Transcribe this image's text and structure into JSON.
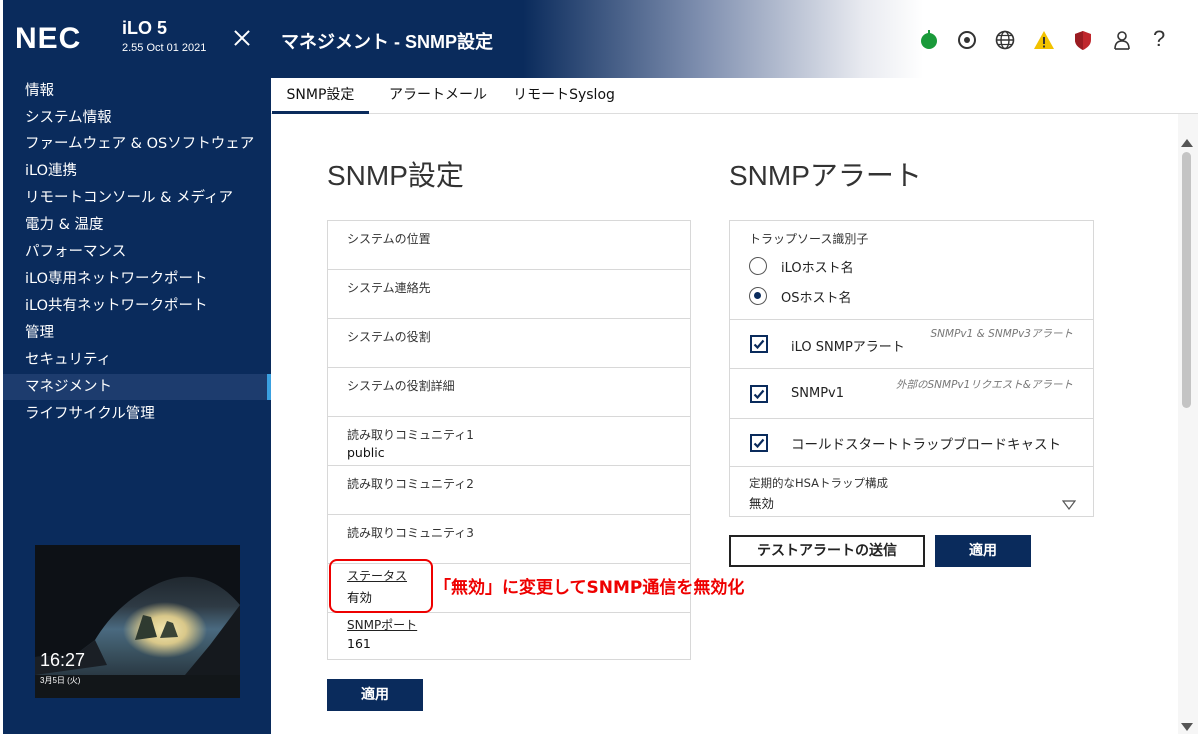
{
  "header": {
    "logo": "NEC",
    "product": "iLO 5",
    "version": "2.55 Oct 01 2021",
    "title": "マネジメント - SNMP設定",
    "icons": [
      "power-status-icon",
      "location-icon",
      "globe-icon",
      "warning-icon",
      "security-shield-icon",
      "user-icon",
      "help-icon"
    ],
    "help_label": "?"
  },
  "sidebar": {
    "items": [
      {
        "label": "情報"
      },
      {
        "label": "システム情報"
      },
      {
        "label": "ファームウェア & OSソフトウェア"
      },
      {
        "label": "iLO連携"
      },
      {
        "label": "リモートコンソール & メディア"
      },
      {
        "label": "電力 & 温度"
      },
      {
        "label": "パフォーマンス"
      },
      {
        "label": "iLO専用ネットワークポート"
      },
      {
        "label": "iLO共有ネットワークポート"
      },
      {
        "label": "管理"
      },
      {
        "label": "セキュリティ"
      },
      {
        "label": "マネジメント"
      },
      {
        "label": "ライフサイクル管理"
      }
    ],
    "active_index": 11,
    "console_thumbnail": {
      "time": "16:27",
      "date": "3月5日 (火)"
    }
  },
  "tabs": [
    {
      "label": "SNMP設定",
      "active": true
    },
    {
      "label": "アラートメール",
      "active": false
    },
    {
      "label": "リモートSyslog",
      "active": false
    }
  ],
  "snmp_settings": {
    "title": "SNMP設定",
    "fields": [
      {
        "label": "システムの位置",
        "value": ""
      },
      {
        "label": "システム連絡先",
        "value": ""
      },
      {
        "label": "システムの役割",
        "value": ""
      },
      {
        "label": "システムの役割詳細",
        "value": ""
      },
      {
        "label": "読み取りコミュニティ1",
        "value": "public"
      },
      {
        "label": "読み取りコミュニティ2",
        "value": ""
      },
      {
        "label": "読み取りコミュニティ3",
        "value": ""
      },
      {
        "label": "ステータス",
        "value": "有効"
      },
      {
        "label": "SNMPポート",
        "value": "161"
      }
    ],
    "apply_label": "適用"
  },
  "snmp_alerts": {
    "title": "SNMPアラート",
    "trap_source_label": "トラップソース識別子",
    "trap_source_options": [
      {
        "label": "iLOホスト名",
        "checked": false
      },
      {
        "label": "OSホスト名",
        "checked": true
      }
    ],
    "checks": [
      {
        "label": "iLO SNMPアラート",
        "note": "SNMPv1 & SNMPv3アラート",
        "checked": true
      },
      {
        "label": "SNMPv1",
        "note": "外部のSNMPv1リクエスト&アラート",
        "checked": true
      },
      {
        "label": "コールドスタートトラップブロードキャスト",
        "note": "",
        "checked": true
      }
    ],
    "hsa_label": "定期的なHSAトラップ構成",
    "hsa_value": "無効",
    "test_alert_label": "テストアラートの送信",
    "apply_label": "適用"
  },
  "annotation": {
    "text": "「無効」に変更してSNMP通信を無効化",
    "color": "#e00000"
  },
  "colors": {
    "navy": "#0a2b5c",
    "power_green": "#1a9a3a",
    "warning_yellow": "#f2c200",
    "shield_red": "#c0272d"
  }
}
